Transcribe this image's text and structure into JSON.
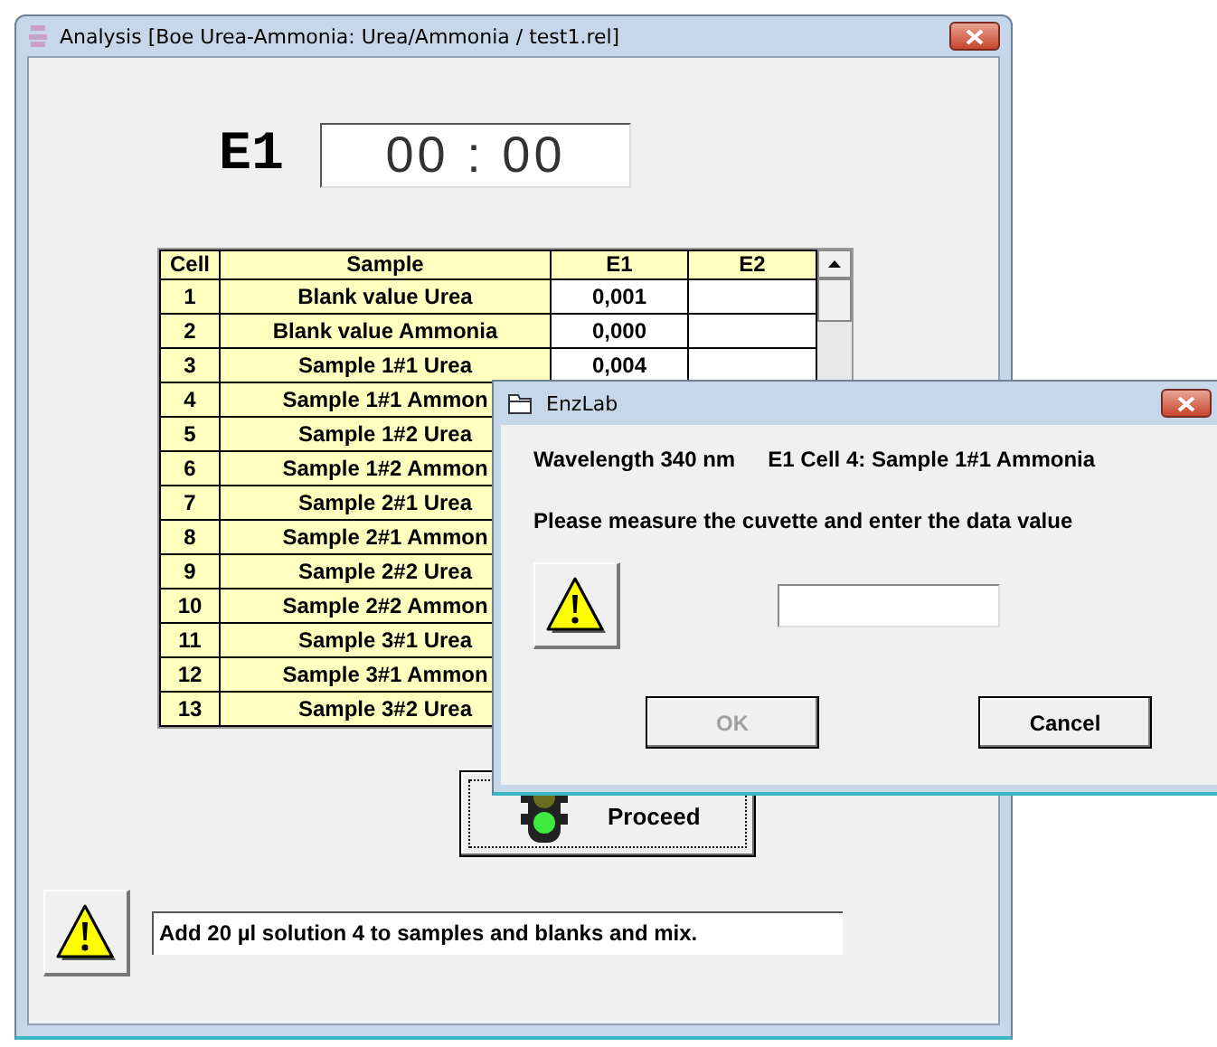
{
  "window": {
    "title": "Analysis  [Boe Urea-Ammonia: Urea/Ammonia / test1.rel]"
  },
  "timer": {
    "label": "E1",
    "value": "00 : 00"
  },
  "table": {
    "columns": [
      "Cell",
      "Sample",
      "E1",
      "E2"
    ],
    "rows": [
      {
        "cell": "1",
        "sample": "Blank value  Urea",
        "e1": "0,001"
      },
      {
        "cell": "2",
        "sample": "Blank value  Ammonia",
        "e1": "0,000"
      },
      {
        "cell": "3",
        "sample": "Sample 1#1 Urea",
        "e1": "0,004"
      },
      {
        "cell": "4",
        "sample": "Sample 1#1 Ammon"
      },
      {
        "cell": "5",
        "sample": "Sample 1#2 Urea"
      },
      {
        "cell": "6",
        "sample": "Sample 1#2 Ammon"
      },
      {
        "cell": "7",
        "sample": "Sample 2#1 Urea"
      },
      {
        "cell": "8",
        "sample": "Sample 2#1 Ammon"
      },
      {
        "cell": "9",
        "sample": "Sample 2#2 Urea"
      },
      {
        "cell": "10",
        "sample": "Sample 2#2 Ammon"
      },
      {
        "cell": "11",
        "sample": "Sample 3#1 Urea"
      },
      {
        "cell": "12",
        "sample": "Sample 3#1 Ammon"
      },
      {
        "cell": "13",
        "sample": "Sample 3#2 Urea"
      }
    ]
  },
  "proceed_button": {
    "label": "Proceed"
  },
  "message": {
    "text": "Add 20 µl solution 4 to samples and blanks and mix."
  },
  "dialog": {
    "title": "EnzLab",
    "wavelength": "Wavelength 340 nm",
    "cell_info": "E1  Cell 4: Sample 1#1 Ammonia",
    "prompt": "Please measure the cuvette and enter the data value",
    "buttons": [
      {
        "label": "OK",
        "disabled": true
      },
      {
        "label": "Cancel",
        "disabled": false
      }
    ]
  }
}
